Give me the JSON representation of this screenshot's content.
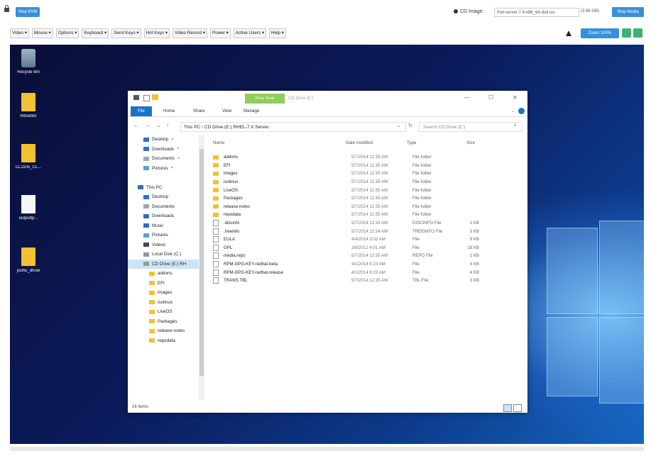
{
  "topbar": {
    "stop_kvm": "Stop KVM",
    "cd_image_label": "CD Image:",
    "cd_image_file": "rhel-server-7.4-x86_64-dvd.iso",
    "cd_image_size": "(3.98 GB)",
    "stop_media": "Stop Media",
    "zoom": "Zoom 100%",
    "colors": {
      "accent": "#3a8fd6",
      "green": "#3cb371"
    }
  },
  "menu": [
    "Video ▾",
    "Mouse ▾",
    "Options ▾",
    "Keyboard ▾",
    "Send Keys ▾",
    "Hot Keys ▾",
    "Video Record ▾",
    "Power ▾",
    "Active Users ▾",
    "Help ▾"
  ],
  "desktop_icons": [
    {
      "label": "Recycle Bin",
      "icon": "recycle-bin-icon"
    },
    {
      "label": "mbsetter",
      "icon": "folder-icon"
    },
    {
      "label": "CL1105_CL...",
      "icon": "folder-icon"
    },
    {
      "label": "outputtp...",
      "icon": "document-icon"
    },
    {
      "label": "jouhu_dhuw",
      "icon": "folder-icon"
    }
  ],
  "explorer": {
    "drive_tools": "Drive Tools",
    "window_title": "CD Drive (E:)",
    "ribbon_tabs": [
      "File",
      "Home",
      "Share",
      "View",
      "Manage"
    ],
    "address": "This PC  ›  CD Drive (E:) RHEL-7.X Server.",
    "search_placeholder": "Search CD Drive (E:)",
    "columns": [
      "Name",
      "Date modified",
      "Type",
      "Size"
    ],
    "nav_items": [
      {
        "label": "Desktop",
        "icon": "desktop-icon",
        "pin": true
      },
      {
        "label": "Downloads",
        "icon": "download-icon",
        "pin": true
      },
      {
        "label": "Documents",
        "icon": "documents-icon",
        "pin": true
      },
      {
        "label": "Pictures",
        "icon": "pictures-icon",
        "pin": true
      },
      {
        "label": "",
        "icon": "",
        "pin": false
      },
      {
        "label": "This PC",
        "icon": "pc-icon",
        "pin": false
      },
      {
        "label": "Desktop",
        "icon": "desktop-icon",
        "pin": false
      },
      {
        "label": "Documents",
        "icon": "documents-icon",
        "pin": false
      },
      {
        "label": "Downloads",
        "icon": "download-icon",
        "pin": false
      },
      {
        "label": "Music",
        "icon": "music-icon",
        "pin": false
      },
      {
        "label": "Pictures",
        "icon": "pictures-icon",
        "pin": false
      },
      {
        "label": "Videos",
        "icon": "videos-icon",
        "pin": false
      },
      {
        "label": "Local Disk (C:)",
        "icon": "disk-icon",
        "pin": false
      },
      {
        "label": "CD Drive (E:) RH",
        "icon": "cd-icon",
        "pin": false,
        "selected": true
      },
      {
        "label": "addons",
        "icon": "folder-icon",
        "pin": false
      },
      {
        "label": "EFI",
        "icon": "folder-icon",
        "pin": false
      },
      {
        "label": "images",
        "icon": "folder-icon",
        "pin": false
      },
      {
        "label": "isolinux",
        "icon": "folder-icon",
        "pin": false
      },
      {
        "label": "LiveOS",
        "icon": "folder-icon",
        "pin": false
      },
      {
        "label": "Packages",
        "icon": "folder-icon",
        "pin": false
      },
      {
        "label": "release-notes",
        "icon": "folder-icon",
        "pin": false
      },
      {
        "label": "repodata",
        "icon": "folder-icon",
        "pin": false
      }
    ],
    "files": [
      {
        "name": "addons",
        "date": "5/7/2014 12:35 AM",
        "type": "File folder",
        "size": "",
        "icon": "folder-icon"
      },
      {
        "name": "EFI",
        "date": "5/7/2014 12:35 AM",
        "type": "File folder",
        "size": "",
        "icon": "folder-icon"
      },
      {
        "name": "images",
        "date": "5/7/2014 12:35 AM",
        "type": "File folder",
        "size": "",
        "icon": "folder-icon"
      },
      {
        "name": "isolinux",
        "date": "5/7/2014 12:35 AM",
        "type": "File folder",
        "size": "",
        "icon": "folder-icon"
      },
      {
        "name": "LiveOS",
        "date": "5/7/2014 12:35 AM",
        "type": "File folder",
        "size": "",
        "icon": "folder-icon"
      },
      {
        "name": "Packages",
        "date": "5/7/2014 12:35 AM",
        "type": "File folder",
        "size": "",
        "icon": "folder-icon"
      },
      {
        "name": "release-notes",
        "date": "5/7/2014 12:35 AM",
        "type": "File folder",
        "size": "",
        "icon": "folder-icon"
      },
      {
        "name": "repodata",
        "date": "5/7/2014 12:35 AM",
        "type": "File folder",
        "size": "",
        "icon": "folder-icon"
      },
      {
        "name": ".discinfo",
        "date": "5/7/2014 12:33 AM",
        "type": "DISCINFO File",
        "size": "1 KB",
        "icon": "file-icon"
      },
      {
        "name": ".treeinfo",
        "date": "5/7/2014 12:34 AM",
        "type": "TREEINFO File",
        "size": "3 KB",
        "icon": "file-icon"
      },
      {
        "name": "EULA",
        "date": "4/4/2014 3:02 AM",
        "type": "File",
        "size": "9 KB",
        "icon": "file-icon"
      },
      {
        "name": "GPL",
        "date": "3/8/2012 4:01 AM",
        "type": "File",
        "size": "18 KB",
        "icon": "file-icon"
      },
      {
        "name": "media.repo",
        "date": "5/7/2014 12:35 AM",
        "type": "REPO File",
        "size": "1 KB",
        "icon": "file-icon"
      },
      {
        "name": "RPM-GPG-KEY-redhat-beta",
        "date": "4/1/2014 6:23 AM",
        "type": "File",
        "size": "4 KB",
        "icon": "file-icon"
      },
      {
        "name": "RPM-GPG-KEY-redhat-release",
        "date": "4/1/2014 6:23 AM",
        "type": "File",
        "size": "4 KB",
        "icon": "file-icon"
      },
      {
        "name": "TRANS.TBL",
        "date": "5/7/2014 12:35 AM",
        "type": "TBL File",
        "size": "3 KB",
        "icon": "file-icon"
      }
    ],
    "status": "16 items"
  }
}
